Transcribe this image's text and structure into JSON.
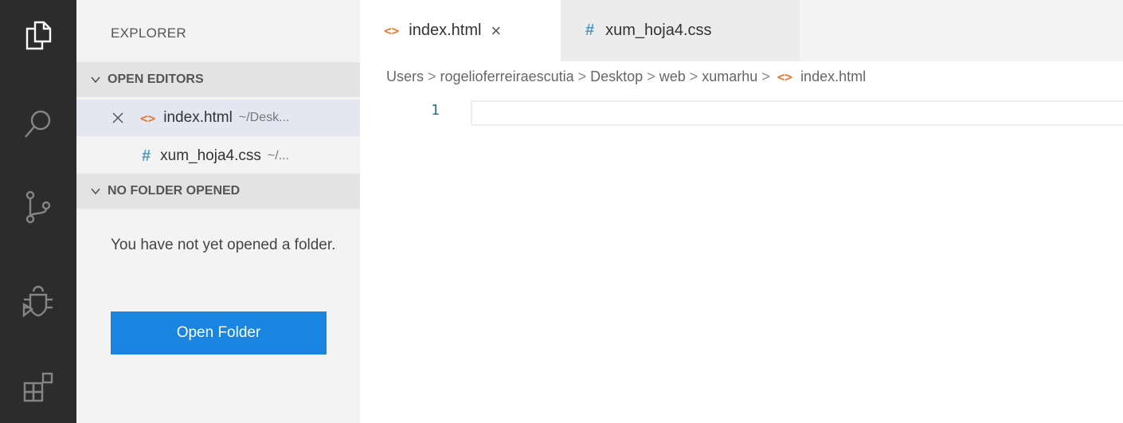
{
  "explorer": {
    "title": "EXPLORER",
    "open_editors": {
      "header": "OPEN EDITORS",
      "items": [
        {
          "icon": "<>",
          "name": "index.html",
          "dir": "~/Desk..."
        },
        {
          "icon": "#",
          "name": "xum_hoja4.css",
          "dir": "~/..."
        }
      ]
    },
    "no_folder": {
      "header": "NO FOLDER OPENED",
      "message": "You have not yet opened a folder.",
      "button_label": "Open Folder"
    }
  },
  "tabs": [
    {
      "icon": "<>",
      "label": "index.html",
      "close": "×"
    },
    {
      "icon": "#",
      "label": "xum_hoja4.css"
    }
  ],
  "breadcrumb": {
    "parts": [
      "Users",
      "rogelioferreiraescutia",
      "Desktop",
      "web",
      "xumarhu"
    ],
    "file_icon": "<>",
    "file": "index.html",
    "sep": ">"
  },
  "editor": {
    "line_number": "1"
  },
  "colors": {
    "activity_bar": "#2c2c2c",
    "sidebar": "#f3f3f3",
    "button": "#1a85e0",
    "html_icon": "#e37933",
    "css_icon": "#519aba",
    "line_number": "#237893"
  }
}
